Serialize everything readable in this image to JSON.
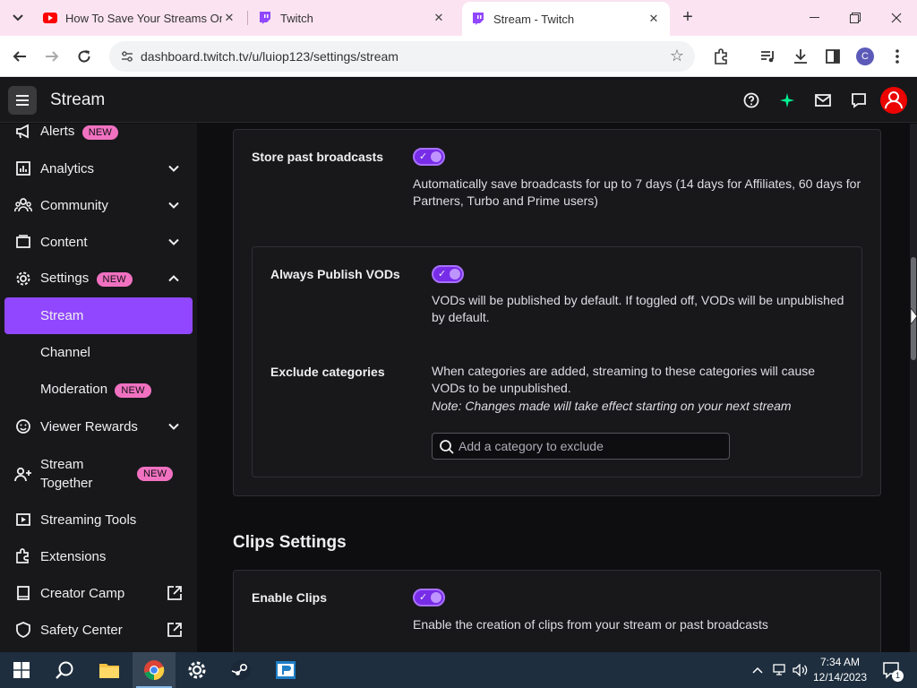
{
  "browser": {
    "tabs": [
      {
        "title": "How To Save Your Streams On",
        "favicon": "youtube-icon",
        "active": false
      },
      {
        "title": "Twitch",
        "favicon": "twitch-icon",
        "active": false
      },
      {
        "title": "Stream - Twitch",
        "favicon": "twitch-icon",
        "active": true
      }
    ],
    "url": "dashboard.twitch.tv/u/luiop123/settings/stream",
    "profile_initial": "C"
  },
  "header": {
    "title": "Stream"
  },
  "sidebar": {
    "badge": "NEW",
    "items": [
      {
        "label": "Alerts",
        "icon": "megaphone-icon",
        "badge": true,
        "chevron": null
      },
      {
        "label": "Analytics",
        "icon": "chart-icon",
        "badge": false,
        "chevron": "down"
      },
      {
        "label": "Community",
        "icon": "community-icon",
        "badge": false,
        "chevron": "down"
      },
      {
        "label": "Content",
        "icon": "content-icon",
        "badge": false,
        "chevron": "down"
      },
      {
        "label": "Settings",
        "icon": "gear-icon",
        "badge": true,
        "chevron": "up"
      },
      {
        "label": "Stream",
        "icon": null,
        "badge": false,
        "chevron": null,
        "active": true
      },
      {
        "label": "Channel",
        "icon": null,
        "badge": false,
        "chevron": null
      },
      {
        "label": "Moderation",
        "icon": null,
        "badge": true,
        "chevron": null
      },
      {
        "label": "Viewer Rewards",
        "icon": "smile-icon",
        "badge": false,
        "chevron": "down"
      },
      {
        "label": "Stream Together",
        "icon": "person-plus-icon",
        "badge": true,
        "chevron": null
      },
      {
        "label": "Streaming Tools",
        "icon": "video-icon",
        "badge": false,
        "chevron": null
      },
      {
        "label": "Extensions",
        "icon": "puzzle-icon",
        "badge": false,
        "chevron": null
      },
      {
        "label": "Creator Camp",
        "icon": "book-icon",
        "badge": false,
        "external": true
      },
      {
        "label": "Safety Center",
        "icon": "shield-icon",
        "badge": false,
        "external": true
      }
    ]
  },
  "vod_settings": {
    "store_past_broadcasts": {
      "label": "Store past broadcasts",
      "enabled": true,
      "description": "Automatically save broadcasts for up to 7 days (14 days for Affiliates, 60 days for Partners, Turbo and Prime users)"
    },
    "always_publish_vods": {
      "label": "Always Publish VODs",
      "enabled": true,
      "description": "VODs will be published by default. If toggled off, VODs will be unpublished by default."
    },
    "exclude_categories": {
      "label": "Exclude categories",
      "description": "When categories are added, streaming to these categories will cause VODs to be unpublished.",
      "note": "Note: Changes made will take effect starting on your next stream",
      "placeholder": "Add a category to exclude",
      "value": ""
    }
  },
  "clips_settings": {
    "heading": "Clips Settings",
    "enable_clips": {
      "label": "Enable Clips",
      "enabled": true,
      "description": "Enable the creation of clips from your stream or past broadcasts"
    }
  },
  "taskbar": {
    "time": "7:34 AM",
    "date": "12/14/2023",
    "notification_count": "1"
  },
  "colors": {
    "accent": "#9147ff",
    "badge": "#f171c1",
    "background": "#0e0e10",
    "panel": "#18181b"
  }
}
